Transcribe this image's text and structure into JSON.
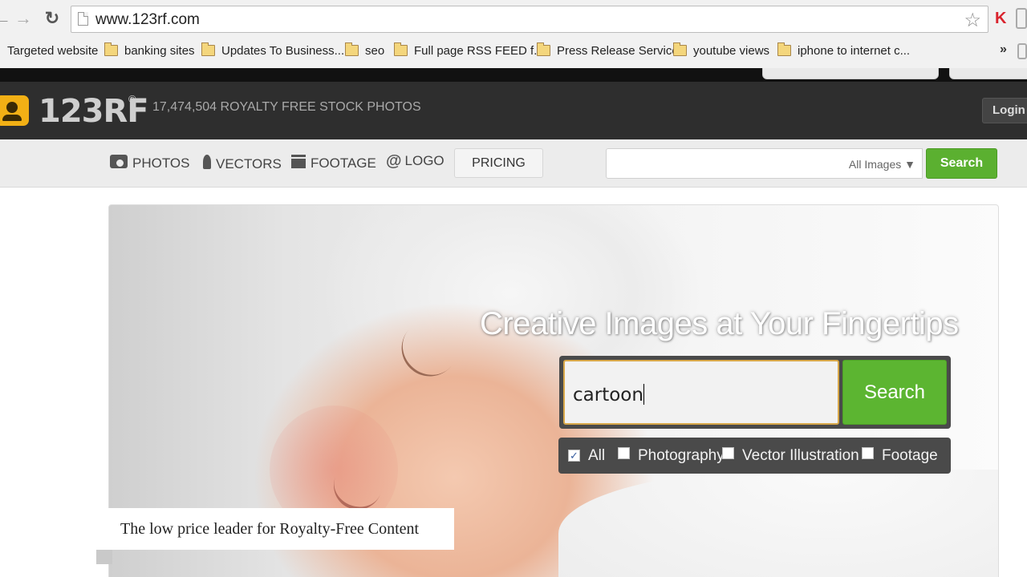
{
  "browser": {
    "url": "www.123rf.com",
    "bookmarks": [
      {
        "label": "Targeted website",
        "folder": false
      },
      {
        "label": "banking sites",
        "folder": true
      },
      {
        "label": "Updates To Business...",
        "folder": true
      },
      {
        "label": "seo",
        "folder": true
      },
      {
        "label": "Full page RSS FEED f...",
        "folder": true
      },
      {
        "label": "Press Release Service",
        "folder": true
      },
      {
        "label": "youtube views",
        "folder": true
      },
      {
        "label": "iphone to internet c...",
        "folder": true
      }
    ],
    "more_label": "»"
  },
  "header": {
    "logo_text": "123RF",
    "logo_reg": "®",
    "stock_count": "17,474,504  ROYALTY FREE STOCK PHOTOS",
    "login_label": "Login"
  },
  "nav": {
    "items": [
      {
        "label": "PHOTOS",
        "icon": "camera-icon"
      },
      {
        "label": "VECTORS",
        "icon": "pen-icon"
      },
      {
        "label": "FOOTAGE",
        "icon": "clapper-icon"
      },
      {
        "label": "LOGO",
        "icon": "at-icon"
      }
    ],
    "pricing_label": "PRICING",
    "search_scope": "All Images ▼",
    "search_label": "Search"
  },
  "hero": {
    "title": "Creative Images at Your Fingertips",
    "search_value": "cartoon",
    "search_label": "Search",
    "filters": [
      {
        "label": "All",
        "checked": true
      },
      {
        "label": "Photography",
        "checked": false
      },
      {
        "label": "Vector Illustration",
        "checked": false
      },
      {
        "label": "Footage",
        "checked": false
      }
    ],
    "tagline": "The low price leader for Royalty-Free Content"
  },
  "colors": {
    "accent_green": "#5cb531",
    "header_dark": "#2e2e2e",
    "logo_yellow": "#f2b015"
  }
}
